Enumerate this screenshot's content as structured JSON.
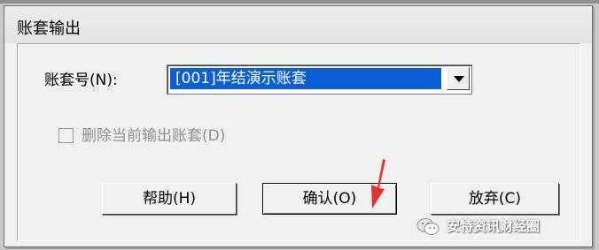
{
  "dialog": {
    "title": "账套输出",
    "account_label": "账套号(N):",
    "account_value": "[001]年结演示账套",
    "checkbox_label": "删除当前输出账套(D)",
    "checkbox_checked": false,
    "checkbox_enabled": false,
    "buttons": {
      "help": "帮助(H)",
      "ok": "确认(O)",
      "cancel": "放弃(C)"
    }
  },
  "watermark": {
    "text": "安特资讯财经圈",
    "icon": "wechat-icon"
  },
  "annotation": {
    "icon": "red-arrow-icon",
    "color": "#e8312b"
  }
}
